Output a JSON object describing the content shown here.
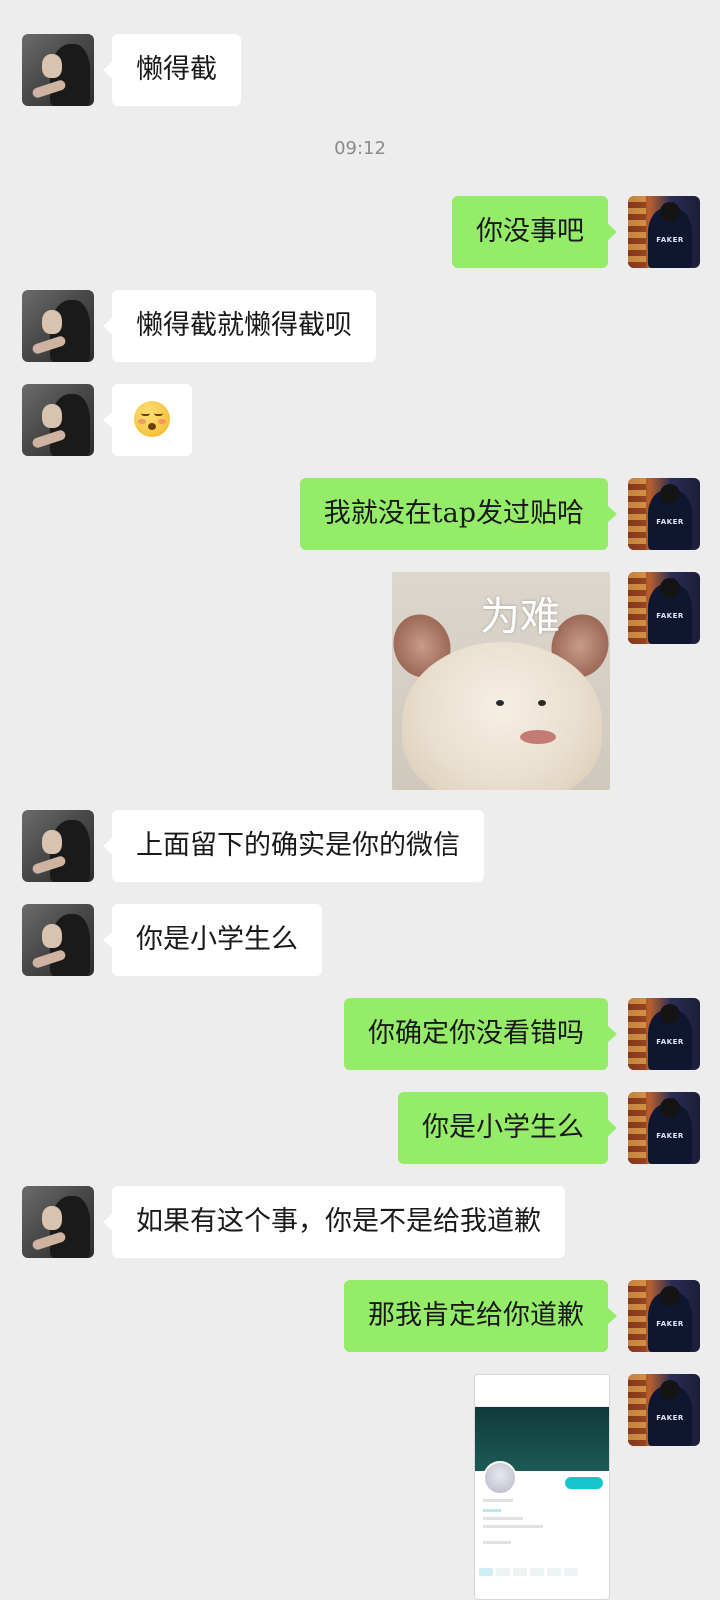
{
  "chat": {
    "timestamp": "09:12",
    "messages": [
      {
        "side": "left",
        "text": "懒得截"
      },
      {
        "side": "right",
        "text": "你没事吧"
      },
      {
        "side": "left",
        "text": "懒得截就懒得截呗"
      },
      {
        "side": "left",
        "emoji": "kissing-closed-eyes-emoji"
      },
      {
        "side": "right",
        "text": "我就没在tap发过贴哈"
      },
      {
        "side": "right",
        "sticker_caption": "为难"
      },
      {
        "side": "left",
        "text": "上面留下的确实是你的微信"
      },
      {
        "side": "left",
        "text": "你是小学生么"
      },
      {
        "side": "right",
        "text": "你确定你没看错吗"
      },
      {
        "side": "right",
        "text": "你是小学生么"
      },
      {
        "side": "left",
        "text": "如果有这个事，你是不是给我道歉"
      },
      {
        "side": "right",
        "text": "那我肯定给你道歉"
      },
      {
        "side": "right",
        "screenshot": "screenshot-thumbnail"
      }
    ]
  },
  "avatars": {
    "right_jersey_text": "FAKER"
  },
  "colors": {
    "background": "#ededed",
    "self_bubble": "#95ec69",
    "other_bubble": "#ffffff",
    "timestamp": "#8a8a8a"
  }
}
